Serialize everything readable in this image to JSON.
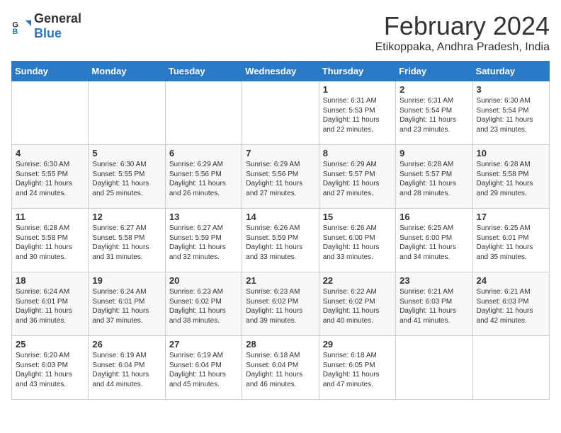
{
  "header": {
    "logo_general": "General",
    "logo_blue": "Blue",
    "title": "February 2024",
    "subtitle": "Etikoppaka, Andhra Pradesh, India"
  },
  "weekdays": [
    "Sunday",
    "Monday",
    "Tuesday",
    "Wednesday",
    "Thursday",
    "Friday",
    "Saturday"
  ],
  "weeks": [
    [
      {
        "day": "",
        "info": ""
      },
      {
        "day": "",
        "info": ""
      },
      {
        "day": "",
        "info": ""
      },
      {
        "day": "",
        "info": ""
      },
      {
        "day": "1",
        "info": "Sunrise: 6:31 AM\nSunset: 5:53 PM\nDaylight: 11 hours and 22 minutes."
      },
      {
        "day": "2",
        "info": "Sunrise: 6:31 AM\nSunset: 5:54 PM\nDaylight: 11 hours and 23 minutes."
      },
      {
        "day": "3",
        "info": "Sunrise: 6:30 AM\nSunset: 5:54 PM\nDaylight: 11 hours and 23 minutes."
      }
    ],
    [
      {
        "day": "4",
        "info": "Sunrise: 6:30 AM\nSunset: 5:55 PM\nDaylight: 11 hours and 24 minutes."
      },
      {
        "day": "5",
        "info": "Sunrise: 6:30 AM\nSunset: 5:55 PM\nDaylight: 11 hours and 25 minutes."
      },
      {
        "day": "6",
        "info": "Sunrise: 6:29 AM\nSunset: 5:56 PM\nDaylight: 11 hours and 26 minutes."
      },
      {
        "day": "7",
        "info": "Sunrise: 6:29 AM\nSunset: 5:56 PM\nDaylight: 11 hours and 27 minutes."
      },
      {
        "day": "8",
        "info": "Sunrise: 6:29 AM\nSunset: 5:57 PM\nDaylight: 11 hours and 27 minutes."
      },
      {
        "day": "9",
        "info": "Sunrise: 6:28 AM\nSunset: 5:57 PM\nDaylight: 11 hours and 28 minutes."
      },
      {
        "day": "10",
        "info": "Sunrise: 6:28 AM\nSunset: 5:58 PM\nDaylight: 11 hours and 29 minutes."
      }
    ],
    [
      {
        "day": "11",
        "info": "Sunrise: 6:28 AM\nSunset: 5:58 PM\nDaylight: 11 hours and 30 minutes."
      },
      {
        "day": "12",
        "info": "Sunrise: 6:27 AM\nSunset: 5:58 PM\nDaylight: 11 hours and 31 minutes."
      },
      {
        "day": "13",
        "info": "Sunrise: 6:27 AM\nSunset: 5:59 PM\nDaylight: 11 hours and 32 minutes."
      },
      {
        "day": "14",
        "info": "Sunrise: 6:26 AM\nSunset: 5:59 PM\nDaylight: 11 hours and 33 minutes."
      },
      {
        "day": "15",
        "info": "Sunrise: 6:26 AM\nSunset: 6:00 PM\nDaylight: 11 hours and 33 minutes."
      },
      {
        "day": "16",
        "info": "Sunrise: 6:25 AM\nSunset: 6:00 PM\nDaylight: 11 hours and 34 minutes."
      },
      {
        "day": "17",
        "info": "Sunrise: 6:25 AM\nSunset: 6:01 PM\nDaylight: 11 hours and 35 minutes."
      }
    ],
    [
      {
        "day": "18",
        "info": "Sunrise: 6:24 AM\nSunset: 6:01 PM\nDaylight: 11 hours and 36 minutes."
      },
      {
        "day": "19",
        "info": "Sunrise: 6:24 AM\nSunset: 6:01 PM\nDaylight: 11 hours and 37 minutes."
      },
      {
        "day": "20",
        "info": "Sunrise: 6:23 AM\nSunset: 6:02 PM\nDaylight: 11 hours and 38 minutes."
      },
      {
        "day": "21",
        "info": "Sunrise: 6:23 AM\nSunset: 6:02 PM\nDaylight: 11 hours and 39 minutes."
      },
      {
        "day": "22",
        "info": "Sunrise: 6:22 AM\nSunset: 6:02 PM\nDaylight: 11 hours and 40 minutes."
      },
      {
        "day": "23",
        "info": "Sunrise: 6:21 AM\nSunset: 6:03 PM\nDaylight: 11 hours and 41 minutes."
      },
      {
        "day": "24",
        "info": "Sunrise: 6:21 AM\nSunset: 6:03 PM\nDaylight: 11 hours and 42 minutes."
      }
    ],
    [
      {
        "day": "25",
        "info": "Sunrise: 6:20 AM\nSunset: 6:03 PM\nDaylight: 11 hours and 43 minutes."
      },
      {
        "day": "26",
        "info": "Sunrise: 6:19 AM\nSunset: 6:04 PM\nDaylight: 11 hours and 44 minutes."
      },
      {
        "day": "27",
        "info": "Sunrise: 6:19 AM\nSunset: 6:04 PM\nDaylight: 11 hours and 45 minutes."
      },
      {
        "day": "28",
        "info": "Sunrise: 6:18 AM\nSunset: 6:04 PM\nDaylight: 11 hours and 46 minutes."
      },
      {
        "day": "29",
        "info": "Sunrise: 6:18 AM\nSunset: 6:05 PM\nDaylight: 11 hours and 47 minutes."
      },
      {
        "day": "",
        "info": ""
      },
      {
        "day": "",
        "info": ""
      }
    ]
  ]
}
